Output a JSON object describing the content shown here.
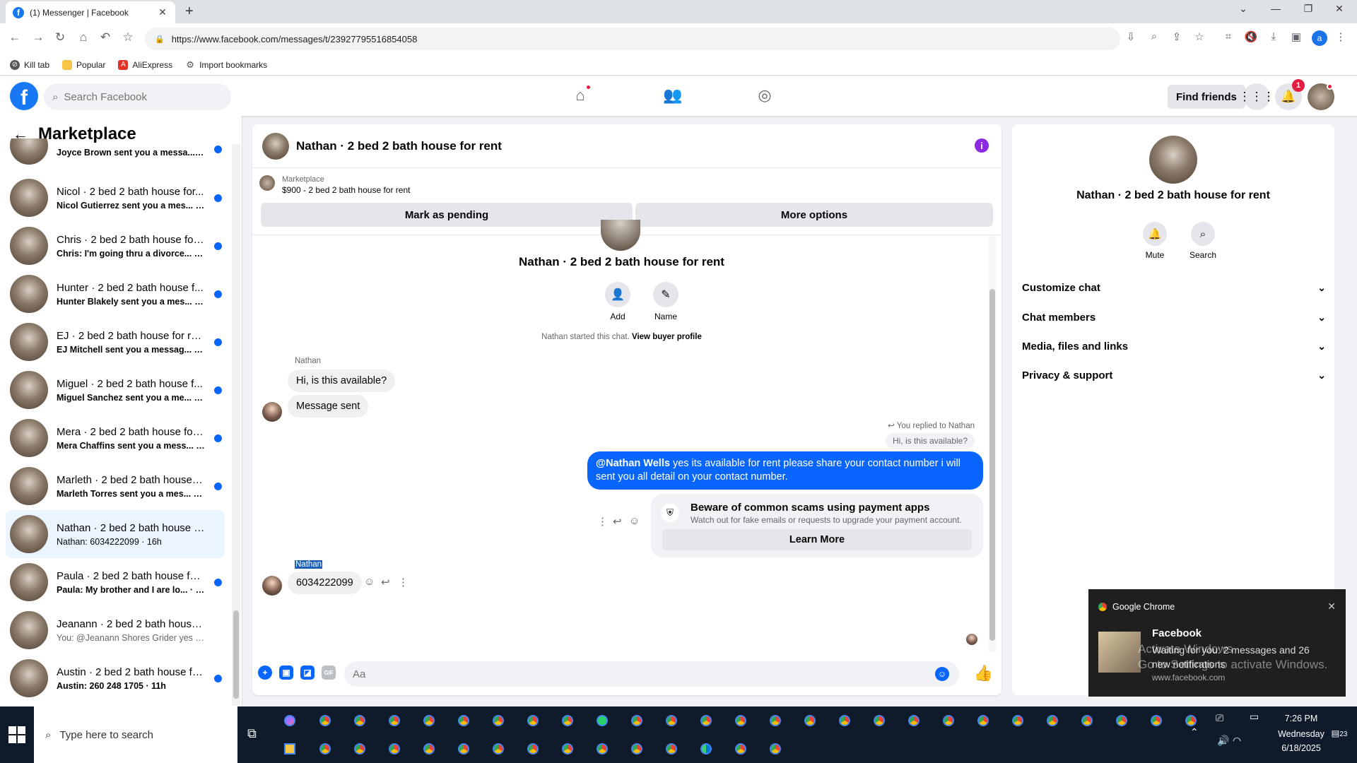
{
  "browser": {
    "tab_title": "(1) Messenger | Facebook",
    "url": "https://www.facebook.com/messages/t/23927795516854058",
    "bookmarks": [
      "Kill tab",
      "Popular",
      "AliExpress",
      "Import bookmarks"
    ],
    "profile_initial": "a"
  },
  "fb": {
    "search_placeholder": "Search Facebook",
    "find_friends": "Find friends",
    "notif_count": "1"
  },
  "sidebar": {
    "title": "Marketplace",
    "conversations": [
      {
        "name": "",
        "preview": "Joyce Brown sent you a messa... · 15h"
      },
      {
        "name": "Nicol · 2 bed 2 bath house for...",
        "preview": "Nicol Gutierrez sent you a mes... · 15h"
      },
      {
        "name": "Chris · 2 bed 2 bath house for ...",
        "preview": "Chris: I'm going thru a divorce... · 15h"
      },
      {
        "name": "Hunter · 2 bed 2 bath house f...",
        "preview": "Hunter Blakely sent you a mes... · 15h"
      },
      {
        "name": "EJ · 2 bed 2 bath house for rent",
        "preview": "EJ Mitchell sent you a messag... · 15h"
      },
      {
        "name": "Miguel · 2 bed 2 bath house f...",
        "preview": "Miguel Sanchez sent you a me... · 15h"
      },
      {
        "name": "Mera · 2 bed 2 bath house for ...",
        "preview": "Mera Chaffins sent you a mess... · 15h"
      },
      {
        "name": "Marleth · 2 bed 2 bath house f...",
        "preview": "Marleth Torres sent you a mes... · 16h"
      },
      {
        "name": "Nathan · 2 bed 2 bath house for...",
        "preview": "Nathan: 6034222099 · 16h"
      },
      {
        "name": "Paula · 2 bed 2 bath house for...",
        "preview": "Paula: My brother and I are lo... · 16h"
      },
      {
        "name": "Jeanann · 2 bed 2 bath house fo...",
        "preview": "You: @Jeanann Shores Grider yes ... · 16h"
      },
      {
        "name": "Austin · 2 bed 2 bath house fo...",
        "preview": "Austin: 260 248 1705 · 11h"
      }
    ]
  },
  "chat": {
    "title": "Nathan · 2 bed 2 bath house for rent",
    "marketplace_label": "Marketplace",
    "listing": "$900 - 2 bed 2 bath house for rent",
    "mark_pending": "Mark as pending",
    "more_options": "More options",
    "center_title": "Nathan · 2 bed 2 bath house for rent",
    "add_label": "Add",
    "name_label": "Name",
    "started_text": "Nathan started this chat.",
    "view_profile": "View buyer profile",
    "sender_name": "Nathan",
    "msg1": "Hi, is this available?",
    "msg2": "Message sent",
    "replied_label": "You replied to Nathan",
    "quoted": "Hi, is this available?",
    "sent_mention": "@Nathan Wells",
    "sent_text": " yes its available for rent please share your contact number i will sent you all detail on your contact number.",
    "scam_title": "Beware of common scams using payment apps",
    "scam_sub": "Watch out for fake emails or requests to upgrade your payment account.",
    "learn_more": "Learn More",
    "sender_name2": "Nathan",
    "msg3": "6034222099",
    "composer_placeholder": "Aa"
  },
  "rpanel": {
    "name": "Nathan · 2 bed 2 bath house for rent",
    "mute": "Mute",
    "search": "Search",
    "rows": [
      "Customize chat",
      "Chat members",
      "Media, files and links",
      "Privacy & support"
    ]
  },
  "toast": {
    "app": "Google Chrome",
    "title": "Facebook",
    "body": "Waiting for you: 2 messages and 26 new notifications",
    "url": "www.facebook.com",
    "watermark1": "Activate Windows",
    "watermark2": "Go to Settings to activate Windows."
  },
  "taskbar": {
    "search_placeholder": "Type here to search",
    "time": "7:26 PM",
    "day": "Wednesday",
    "date": "6/18/2025",
    "notif": "23"
  },
  "colors": {
    "fb_blue": "#1877f2",
    "messenger_blue": "#0866ff",
    "active_bg": "#ebf5ff"
  }
}
